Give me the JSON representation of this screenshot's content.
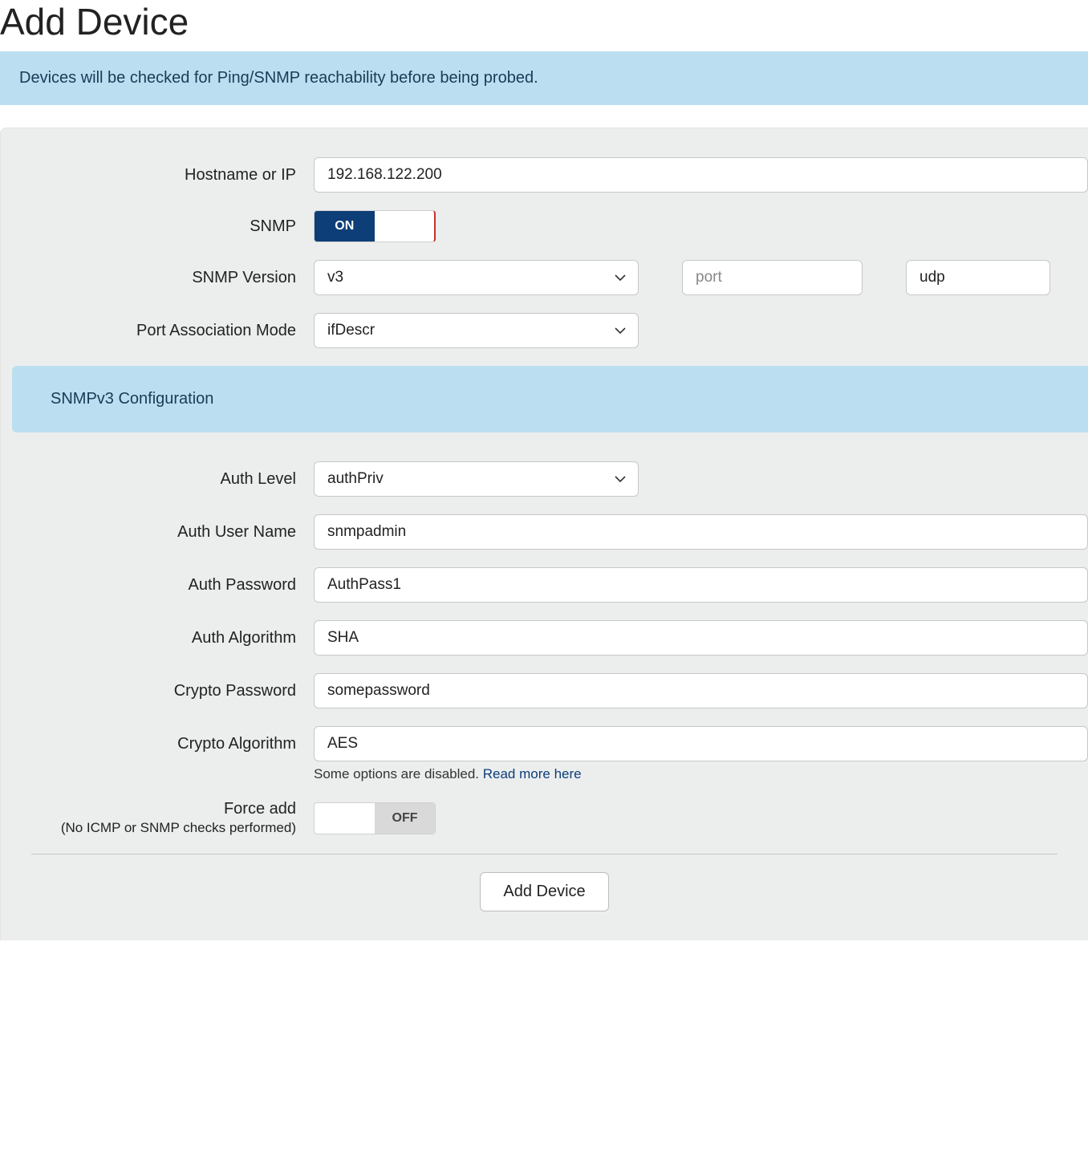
{
  "title": "Add Device",
  "banner": "Devices will be checked for Ping/SNMP reachability before being probed.",
  "labels": {
    "hostname": "Hostname or IP",
    "snmp": "SNMP",
    "snmp_version": "SNMP Version",
    "port_assoc": "Port Association Mode",
    "auth_level": "Auth Level",
    "auth_user": "Auth User Name",
    "auth_pass": "Auth Password",
    "auth_algo": "Auth Algorithm",
    "crypto_pass": "Crypto Password",
    "crypto_algo": "Crypto Algorithm",
    "force_add": "Force add",
    "force_add_sub": "(No ICMP or SNMP checks performed)"
  },
  "section": {
    "snmpv3": "SNMPv3 Configuration"
  },
  "values": {
    "hostname": "192.168.122.200",
    "snmp_on": "ON",
    "snmp_version": "v3",
    "port_placeholder": "port",
    "proto": "udp",
    "port_assoc": "ifDescr",
    "auth_level": "authPriv",
    "auth_user": "snmpadmin",
    "auth_pass": "AuthPass1",
    "auth_algo": "SHA",
    "crypto_pass": "somepassword",
    "crypto_algo": "AES",
    "force_off": "OFF"
  },
  "hint": {
    "text": "Some options are disabled. ",
    "link": "Read more here"
  },
  "buttons": {
    "submit": "Add Device"
  }
}
